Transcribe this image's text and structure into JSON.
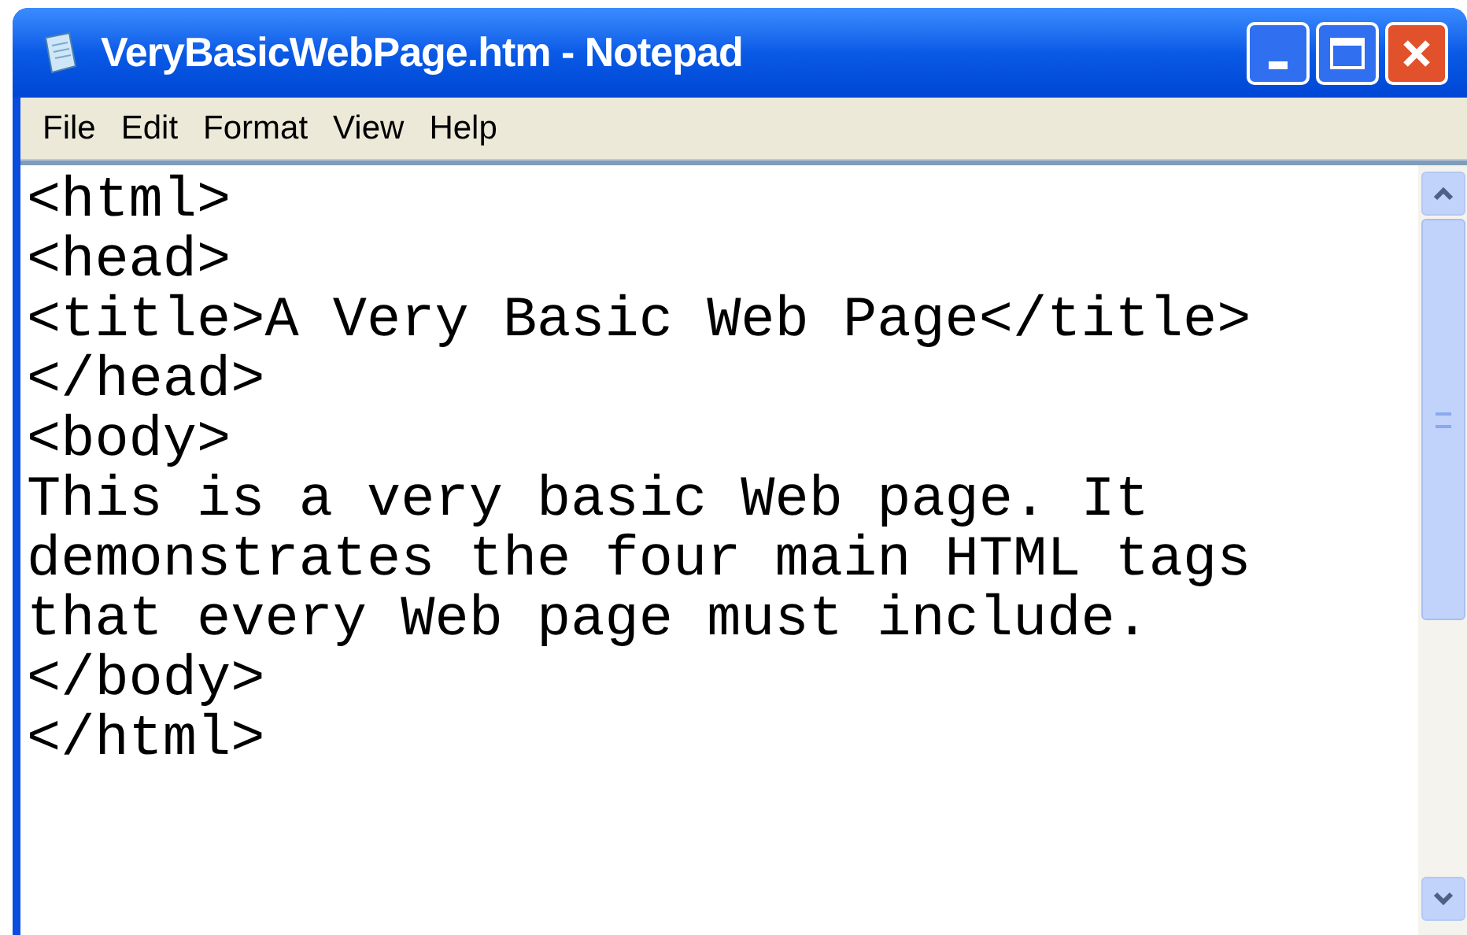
{
  "window": {
    "title": "VeryBasicWebPage.htm - Notepad"
  },
  "menu": [
    "File",
    "Edit",
    "Format",
    "View",
    "Help"
  ],
  "editor": {
    "lines": [
      "<html>",
      "<head>",
      "<title>A Very Basic Web Page</title>",
      "</head>",
      "<body>",
      "This is a very basic Web page. It",
      "demonstrates the four main HTML tags",
      "that every Web page must include.",
      "</body>",
      "</html>"
    ]
  }
}
